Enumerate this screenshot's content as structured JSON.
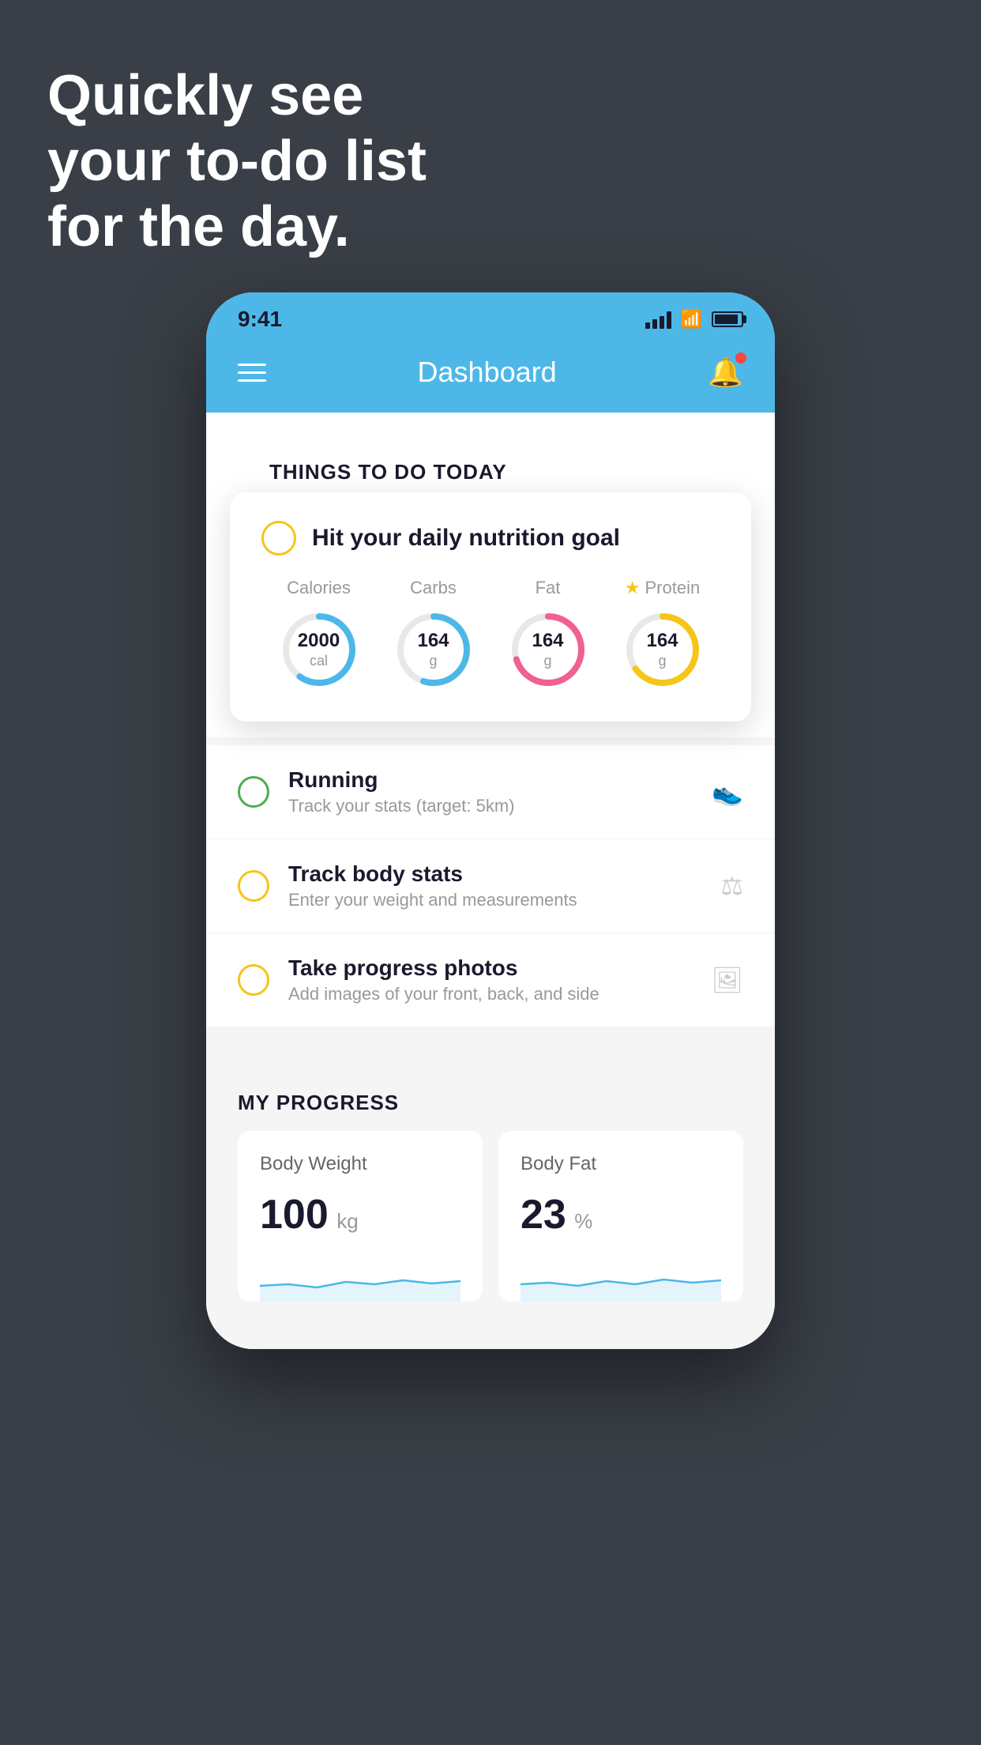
{
  "hero": {
    "line1": "Quickly see",
    "line2": "your to-do list",
    "line3": "for the day."
  },
  "status_bar": {
    "time": "9:41"
  },
  "header": {
    "title": "Dashboard"
  },
  "things_to_do": {
    "section_title": "THINGS TO DO TODAY",
    "nutrition_card": {
      "title": "Hit your daily nutrition goal",
      "items": [
        {
          "label": "Calories",
          "value": "2000",
          "unit": "cal",
          "color": "blue",
          "percent": 60
        },
        {
          "label": "Carbs",
          "value": "164",
          "unit": "g",
          "color": "blue",
          "percent": 55
        },
        {
          "label": "Fat",
          "value": "164",
          "unit": "g",
          "color": "pink",
          "percent": 70
        },
        {
          "label": "Protein",
          "value": "164",
          "unit": "g",
          "color": "yellow",
          "percent": 65,
          "starred": true
        }
      ]
    },
    "todo_items": [
      {
        "circle": "green",
        "main": "Running",
        "sub": "Track your stats (target: 5km)",
        "icon": "👟"
      },
      {
        "circle": "yellow",
        "main": "Track body stats",
        "sub": "Enter your weight and measurements",
        "icon": "⚖️"
      },
      {
        "circle": "yellow2",
        "main": "Take progress photos",
        "sub": "Add images of your front, back, and side",
        "icon": "🖼️"
      }
    ]
  },
  "my_progress": {
    "section_title": "MY PROGRESS",
    "cards": [
      {
        "title": "Body Weight",
        "value": "100",
        "unit": "kg"
      },
      {
        "title": "Body Fat",
        "value": "23",
        "unit": "%"
      }
    ]
  }
}
